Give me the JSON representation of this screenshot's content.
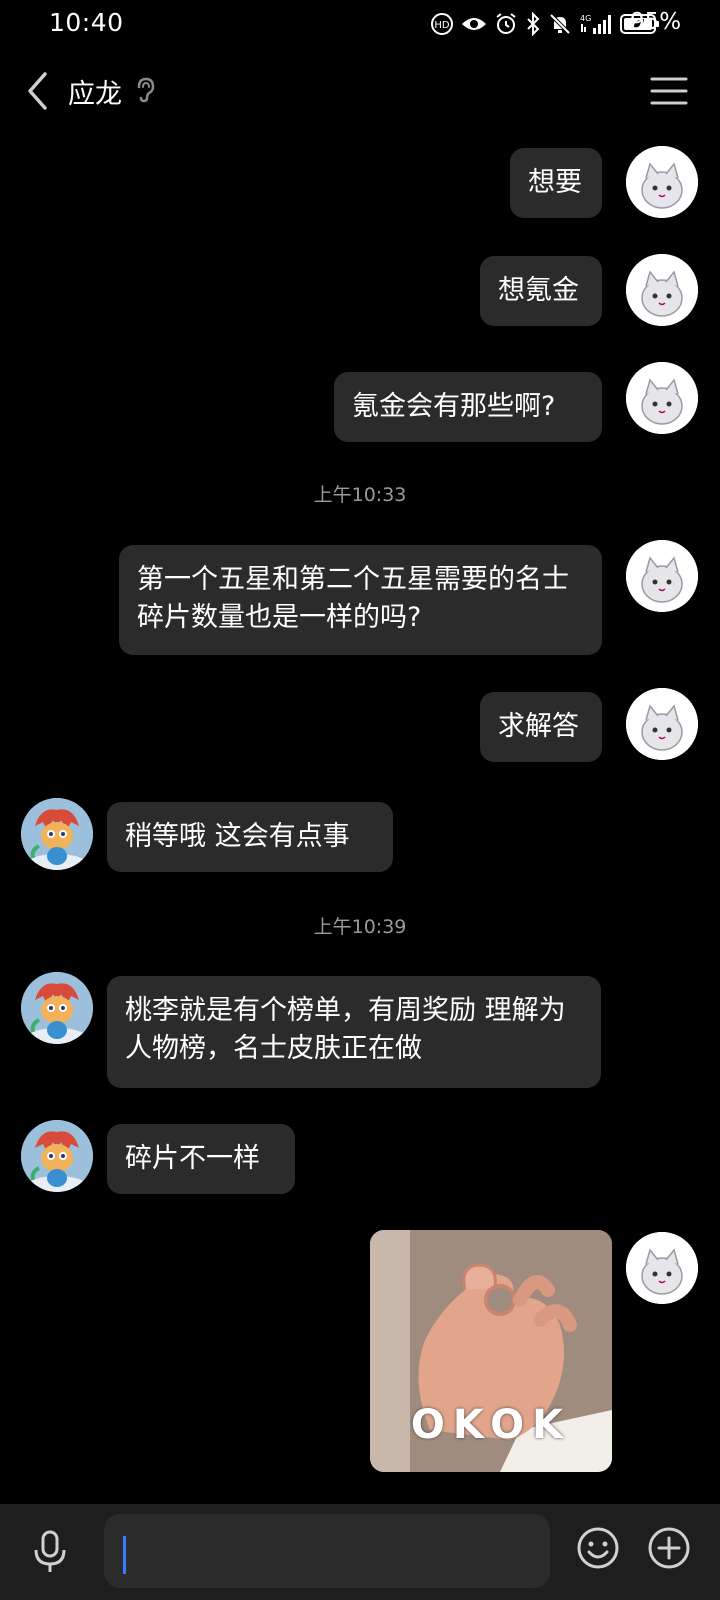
{
  "status_bar": {
    "time": "10:40",
    "battery_percent": "95%",
    "network_label": "4G",
    "icons": [
      "lte-hd-icon",
      "eye-icon",
      "alarm-icon",
      "bluetooth-icon",
      "mute-icon",
      "signal-icon",
      "battery-icon"
    ]
  },
  "header": {
    "contact_name": "应龙",
    "icons": [
      "back-arrow-icon",
      "ear-icon",
      "menu-icon"
    ]
  },
  "timestamps": [
    "上午10:33",
    "上午10:39"
  ],
  "messages": [
    {
      "sender": "me",
      "text": "想要"
    },
    {
      "sender": "me",
      "text": "想氪金"
    },
    {
      "sender": "me",
      "text": "氪金会有那些啊?"
    },
    {
      "sender": "me",
      "text": "第一个五星和第二个五星需要的名士碎片数量也是一样的吗?"
    },
    {
      "sender": "me",
      "text": "求解答"
    },
    {
      "sender": "them",
      "text": "稍等哦 这会有点事"
    },
    {
      "sender": "them",
      "text": "桃李就是有个榜单，有周奖励 理解为人物榜，名士皮肤正在做"
    },
    {
      "sender": "them",
      "text": "碎片不一样"
    },
    {
      "sender": "me",
      "type": "sticker",
      "caption": "OKOK"
    }
  ],
  "input_bar": {
    "value": "",
    "placeholder": "",
    "icons": [
      "microphone-icon",
      "emoji-icon",
      "plus-icon"
    ]
  },
  "colors": {
    "background": "#000000",
    "bubble": "#2b2b2b",
    "timestamp": "#9a9a9a",
    "input_bar": "#1e1e1e",
    "cursor": "#3a7bff"
  }
}
